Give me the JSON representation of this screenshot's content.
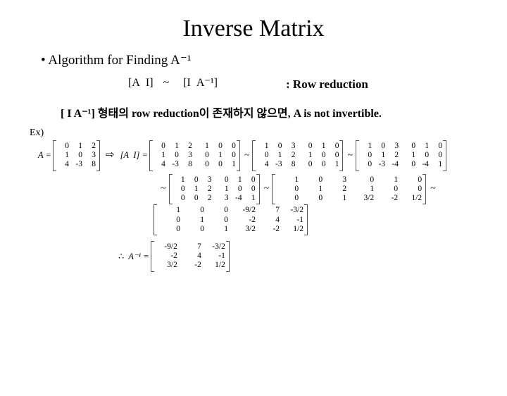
{
  "title": "Inverse Matrix",
  "subheading": "• Algorithm for Finding A⁻¹",
  "row_reduction": {
    "expr_left": "[A  I]",
    "tilde": "~",
    "expr_right": "[I  A⁻¹]",
    "label": ":  Row reduction"
  },
  "condition": "[ I  A⁻¹]  형태의 row reduction이 존재하지 않으면, A is not invertible.",
  "example_label": "Ex)",
  "A_label": "A =",
  "AI_label": "[A  I] =",
  "therefore": "∴",
  "Ainv_label": "A⁻¹ =",
  "arrow": "⇨",
  "tilde_sym": "~",
  "matrices": {
    "A": [
      [
        "0",
        "1",
        "2"
      ],
      [
        "1",
        "0",
        "3"
      ],
      [
        "4",
        "-3",
        "8"
      ]
    ],
    "AI": [
      [
        "0",
        "1",
        "2",
        "1",
        "0",
        "0"
      ],
      [
        "1",
        "0",
        "3",
        "0",
        "1",
        "0"
      ],
      [
        "4",
        "-3",
        "8",
        "0",
        "0",
        "1"
      ]
    ],
    "s1": [
      [
        "1",
        "0",
        "3",
        "0",
        "1",
        "0"
      ],
      [
        "0",
        "1",
        "2",
        "1",
        "0",
        "0"
      ],
      [
        "4",
        "-3",
        "8",
        "0",
        "0",
        "1"
      ]
    ],
    "s2": [
      [
        "1",
        "0",
        "3",
        "0",
        "1",
        "0"
      ],
      [
        "0",
        "1",
        "2",
        "1",
        "0",
        "0"
      ],
      [
        "0",
        "-3",
        "-4",
        "0",
        "-4",
        "1"
      ]
    ],
    "s3": [
      [
        "1",
        "0",
        "3",
        "0",
        "1",
        "0"
      ],
      [
        "0",
        "1",
        "2",
        "1",
        "0",
        "0"
      ],
      [
        "0",
        "0",
        "2",
        "3",
        "-4",
        "1"
      ]
    ],
    "s4": [
      [
        "1",
        "0",
        "3",
        "0",
        "1",
        "0"
      ],
      [
        "0",
        "1",
        "2",
        "1",
        "0",
        "0"
      ],
      [
        "0",
        "0",
        "1",
        "3/2",
        "-2",
        "1/2"
      ]
    ],
    "s5": [
      [
        "1",
        "0",
        "0",
        "-9/2",
        "7",
        "-3/2"
      ],
      [
        "0",
        "1",
        "0",
        "-2",
        "4",
        "-1"
      ],
      [
        "0",
        "0",
        "1",
        "3/2",
        "-2",
        "1/2"
      ]
    ],
    "Ainv": [
      [
        "-9/2",
        "7",
        "-3/2"
      ],
      [
        "-2",
        "4",
        "-1"
      ],
      [
        "3/2",
        "-2",
        "1/2"
      ]
    ]
  }
}
